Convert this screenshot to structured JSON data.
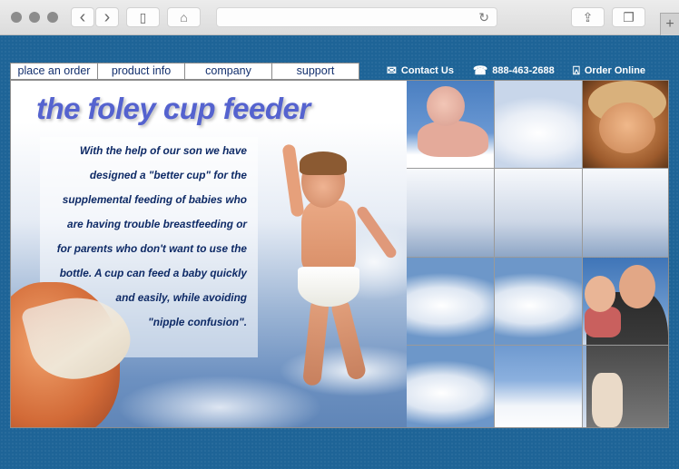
{
  "browser": {
    "buttons": {
      "back": "‹",
      "forward": "›",
      "sidebar": "▯",
      "home": "⌂",
      "reload": "↻",
      "share": "⇪",
      "tabs": "❐",
      "new_tab": "+"
    },
    "url": ""
  },
  "nav": {
    "items": [
      {
        "label": "place an order"
      },
      {
        "label": "product info"
      },
      {
        "label": "company"
      },
      {
        "label": "support"
      }
    ]
  },
  "utility": {
    "contact": {
      "icon": "envelope-icon",
      "label": "Contact Us"
    },
    "phone": {
      "icon": "telephone-icon",
      "label": "888-463-2688"
    },
    "order": {
      "icon": "shopping-bag-icon",
      "label": "Order Online"
    }
  },
  "hero": {
    "title": "the foley cup feeder",
    "blurb_lines": [
      "With the help of our son we have",
      "designed a \"better cup\" for the",
      "supplemental feeding of babies who",
      "are having trouble breastfeeding or",
      "for parents who don't want to use the",
      "bottle. A cup can feed a baby quickly",
      "and easily, while avoiding",
      "\"nipple confusion\"."
    ]
  },
  "colors": {
    "page_background": "#1e6497",
    "title": "#5563cf",
    "body_text": "#0e2a66",
    "nav_text": "#13306e"
  }
}
